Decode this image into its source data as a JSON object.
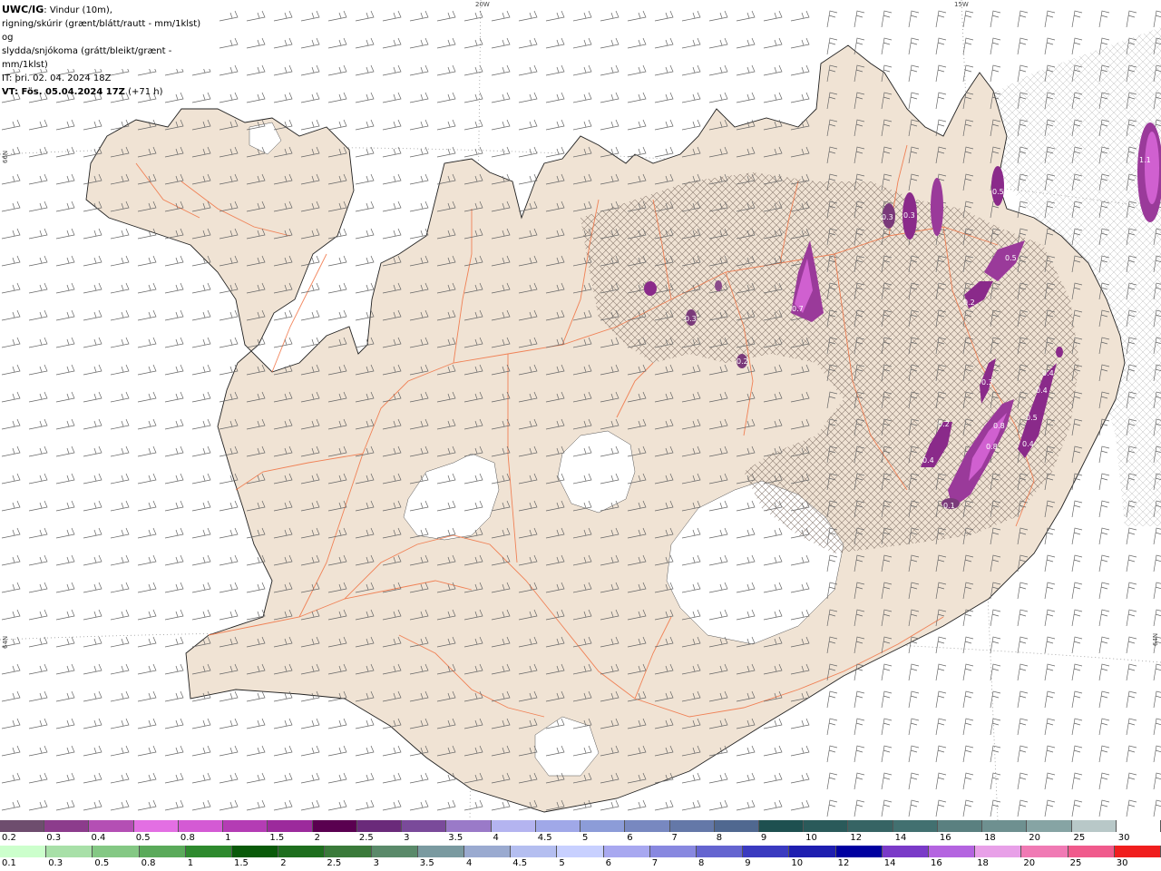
{
  "header": {
    "title_bold": "UWC/IG",
    "title_line1_rest": ": Vindur (10m),",
    "title_line2": "rigning/skúrir (grænt/blátt/rautt - mm/1klst) og",
    "title_line3": "slydda/snjókoma (grátt/bleikt/grænt - mm/1klst)",
    "issue_time": "IT: þri. 02. 04. 2024 18Z",
    "valid_time": "VT: Fös. 05.04.2024 17Z",
    "lead_time": "(+71 h)"
  },
  "coordinates": {
    "lon_20w": "20W",
    "lon_15w": "15W",
    "lat_66n_left": "66N",
    "lat_64n_left": "64N",
    "lat_64n_right": "64N"
  },
  "precip_labels": [
    {
      "value": "1.1"
    },
    {
      "value": "0.5"
    },
    {
      "value": "0.3"
    },
    {
      "value": "0.3"
    },
    {
      "value": "0.5"
    },
    {
      "value": "0.7"
    },
    {
      "value": "0.3"
    },
    {
      "value": "0.2"
    },
    {
      "value": "0.4"
    },
    {
      "value": "0.4"
    },
    {
      "value": "0.5"
    },
    {
      "value": "0.8"
    },
    {
      "value": "0.8"
    },
    {
      "value": "0.4"
    },
    {
      "value": "0.4"
    },
    {
      "value": "0.2"
    },
    {
      "value": "0.3"
    },
    {
      "value": "0.2"
    },
    {
      "value": "0.1"
    }
  ],
  "legend_snow": {
    "labels": [
      "0.2",
      "0.3",
      "0.4",
      "0.5",
      "0.8",
      "1",
      "1.5",
      "2",
      "2.5",
      "3",
      "3.5",
      "4",
      "4.5",
      "5",
      "6",
      "7",
      "8",
      "9",
      "10",
      "12",
      "14",
      "16",
      "18",
      "20",
      "25",
      "30"
    ],
    "colors": [
      "#6e4d6e",
      "#8c3c8c",
      "#b44fb4",
      "#e36fe3",
      "#d45ad4",
      "#b43cb4",
      "#9c2a9c",
      "#5a0050",
      "#6a2a7a",
      "#7a4a9a",
      "#9a7ac8",
      "#b4b4f0",
      "#a0a8e8",
      "#8c9cd8",
      "#7888c0",
      "#6478a8",
      "#506890",
      "#1e5050",
      "#2a5a5a",
      "#366464",
      "#427070",
      "#5a8080",
      "#6e9090",
      "#86a4a4",
      "#b8c8c8",
      "#ffffff"
    ]
  },
  "legend_rain": {
    "labels": [
      "0.1",
      "0.3",
      "0.5",
      "0.8",
      "1",
      "1.5",
      "2",
      "2.5",
      "3",
      "3.5",
      "4",
      "4.5",
      "5",
      "6",
      "7",
      "8",
      "9",
      "10",
      "12",
      "14",
      "16",
      "18",
      "20",
      "25",
      "30"
    ],
    "colors": [
      "#ccffcc",
      "#a8e0a8",
      "#84c884",
      "#5aaa5a",
      "#2e8a2e",
      "#0a5a0a",
      "#1e6e1e",
      "#3a7a3a",
      "#5a8a6a",
      "#7a9aa0",
      "#9aaad0",
      "#b4bef0",
      "#c8d0ff",
      "#a8a8f0",
      "#8888e0",
      "#6464d0",
      "#3a3ac0",
      "#1e1eb0",
      "#0000a0",
      "#7a3ac8",
      "#b464e0",
      "#e8a0e8",
      "#f07ab4",
      "#f05a8c",
      "#f01e1e"
    ]
  }
}
